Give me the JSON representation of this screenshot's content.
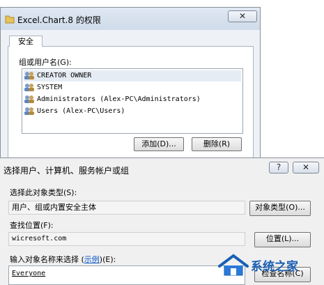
{
  "permissions_dialog": {
    "title": "Excel.Chart.8 的权限",
    "close_glyph": "✕",
    "tab_security": "安全",
    "group_label": "组或用户名(G):",
    "users": [
      "CREATOR OWNER",
      "SYSTEM",
      "Administrators (Alex-PC\\Administrators)",
      "Users (Alex-PC\\Users)"
    ],
    "add_button": "添加(D)...",
    "remove_button": "删除(R)"
  },
  "select_dialog": {
    "title": "选择用户、计算机、服务帐户或组",
    "help_glyph": "?",
    "close_glyph": "✕",
    "object_type_label": "选择此对象类型(S):",
    "object_type_value": "用户、组或内置安全主体",
    "object_type_button": "对象类型(O)...",
    "location_label": "查找位置(F):",
    "location_value": "wicresoft.com",
    "location_button": "位置(L)...",
    "names_label_prefix": "输入对象名称来选择 (",
    "names_label_link": "示例",
    "names_label_suffix": ")(E):",
    "names_value": "Everyone",
    "check_names_button": "检查名称(C)"
  },
  "watermark": {
    "text": "系统之家"
  },
  "colors": {
    "accent": "#0b57c8",
    "selection": "#e6ecf4"
  }
}
